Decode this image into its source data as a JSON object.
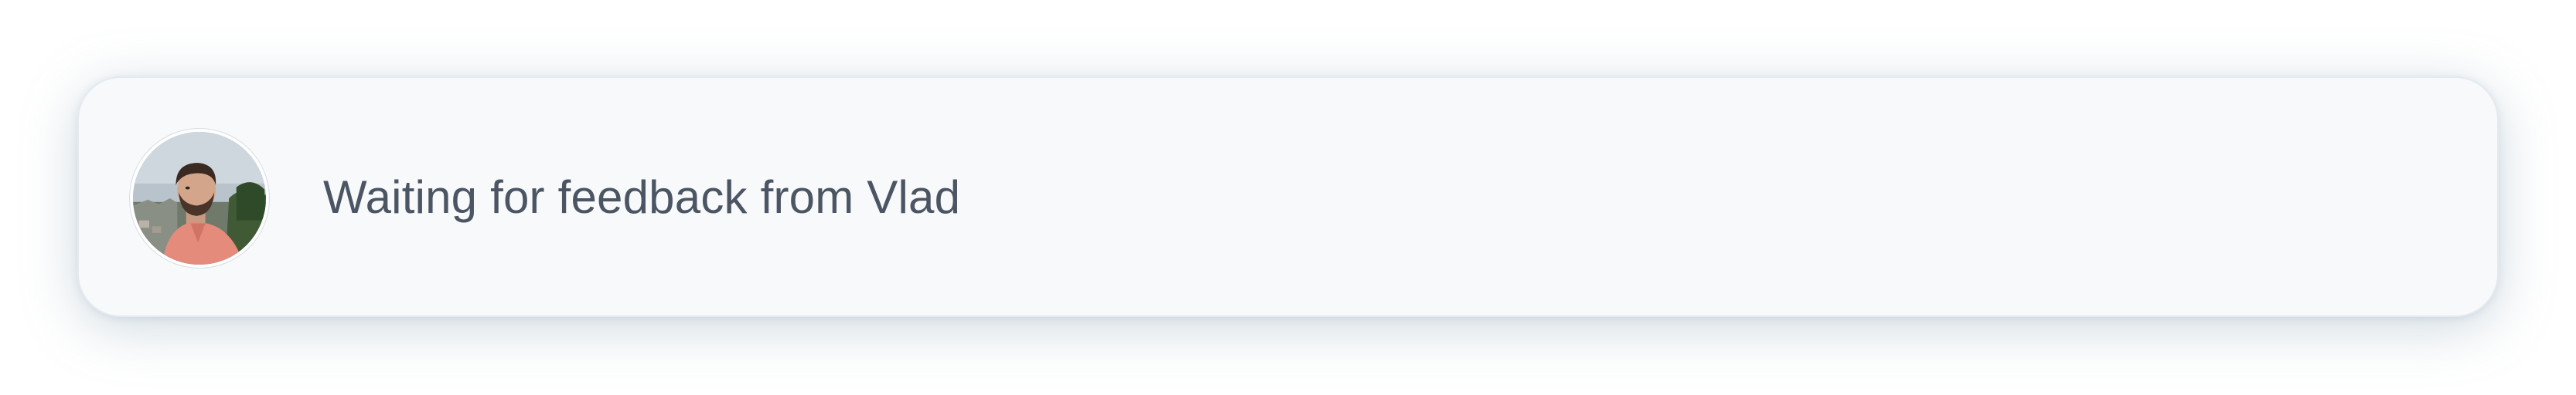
{
  "notification": {
    "avatar": {
      "icon": "user-avatar-photo"
    },
    "message": "Waiting for feedback from Vlad"
  },
  "colors": {
    "card_background": "#f7f9fb",
    "text": "#4b5563"
  }
}
